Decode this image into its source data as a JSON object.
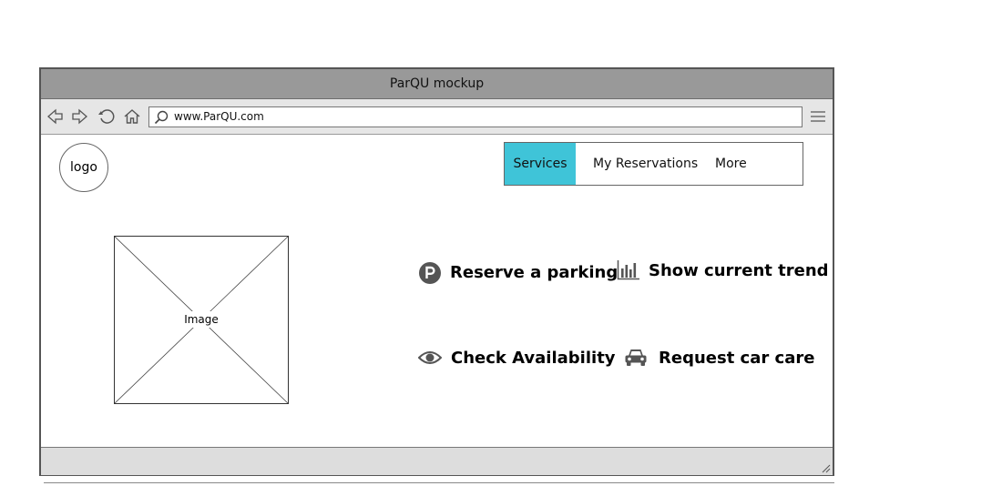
{
  "window": {
    "title": "ParQU mockup"
  },
  "browser": {
    "url": "www.ParQU.com",
    "icons": [
      "back-arrow-icon",
      "forward-arrow-icon",
      "reload-icon",
      "home-icon",
      "search-icon",
      "hamburger-menu-icon"
    ]
  },
  "header": {
    "logo": "logo",
    "tabs": [
      {
        "label": "Services",
        "active": true
      },
      {
        "label": "My Reservations",
        "active": false
      },
      {
        "label": "More",
        "active": false
      }
    ]
  },
  "hero": {
    "image_label": "Image"
  },
  "actions": [
    {
      "label": "Reserve a parking",
      "icon": "parking-icon"
    },
    {
      "label": "Show current trend",
      "icon": "bar-chart-icon"
    },
    {
      "label": "Check Availability",
      "icon": "eye-icon"
    },
    {
      "label": "Request car care",
      "icon": "car-icon"
    }
  ],
  "colors": {
    "active_tab": "#3fc4d8",
    "titlebar": "#999999",
    "toolbar": "#e6e6e6",
    "icon": "#555555"
  }
}
